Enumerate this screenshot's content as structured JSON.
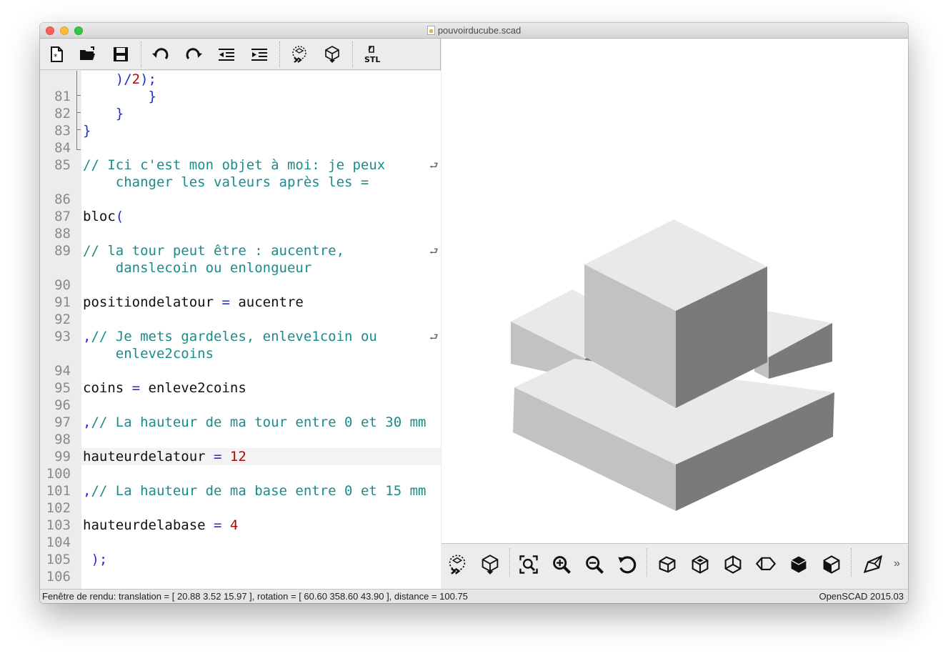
{
  "window": {
    "title": "pouvoirducube.scad"
  },
  "editor_toolbar": {
    "buttons": [
      {
        "name": "new-file",
        "icon": "new-file-icon"
      },
      {
        "name": "open-file",
        "icon": "open-folder-icon"
      },
      {
        "name": "save-file",
        "icon": "save-icon"
      },
      {
        "name": "undo",
        "icon": "undo-icon"
      },
      {
        "name": "redo",
        "icon": "redo-icon"
      },
      {
        "name": "unindent",
        "icon": "unindent-icon"
      },
      {
        "name": "indent",
        "icon": "indent-icon"
      },
      {
        "name": "preview",
        "icon": "preview-icon"
      },
      {
        "name": "render",
        "icon": "render-icon"
      },
      {
        "name": "export-stl",
        "icon": "stl-icon",
        "label": "STL"
      }
    ]
  },
  "code": {
    "current_line": "99",
    "lines": [
      {
        "num": "",
        "text": "    )/2);"
      },
      {
        "num": "81",
        "text": "        }"
      },
      {
        "num": "82",
        "text": "    }"
      },
      {
        "num": "83",
        "text": "}"
      },
      {
        "num": "84",
        "text": ""
      },
      {
        "num": "85",
        "text": "// Ici c'est mon objet à moi: je peux"
      },
      {
        "num": "",
        "text": "    changer les valeurs après les ="
      },
      {
        "num": "86",
        "text": ""
      },
      {
        "num": "87",
        "text": "bloc("
      },
      {
        "num": "88",
        "text": ""
      },
      {
        "num": "89",
        "text": "// la tour peut être : aucentre,"
      },
      {
        "num": "",
        "text": "    danslecoin ou enlongueur"
      },
      {
        "num": "90",
        "text": ""
      },
      {
        "num": "91",
        "text": "positiondelatour = aucentre"
      },
      {
        "num": "92",
        "text": ""
      },
      {
        "num": "93",
        "text": ",// Je mets gardeles, enleve1coin ou"
      },
      {
        "num": "",
        "text": "    enleve2coins"
      },
      {
        "num": "94",
        "text": ""
      },
      {
        "num": "95",
        "text": "coins = enleve2coins"
      },
      {
        "num": "96",
        "text": ""
      },
      {
        "num": "97",
        "text": ",// La hauteur de ma tour entre 0 et 30 mm"
      },
      {
        "num": "98",
        "text": ""
      },
      {
        "num": "99",
        "text": "hauteurdelatour = 12"
      },
      {
        "num": "100",
        "text": ""
      },
      {
        "num": "101",
        "text": ",// La hauteur de ma base entre 0 et 15 mm"
      },
      {
        "num": "102",
        "text": ""
      },
      {
        "num": "103",
        "text": "hauteurdelabase = 4"
      },
      {
        "num": "104",
        "text": ""
      },
      {
        "num": "105",
        "text": " );"
      },
      {
        "num": "106",
        "text": ""
      }
    ],
    "wrap_marker": "⮐"
  },
  "viewer_toolbar": {
    "buttons": [
      {
        "name": "preview",
        "icon": "preview-icon"
      },
      {
        "name": "render",
        "icon": "render-icon"
      },
      {
        "name": "view-all",
        "icon": "zoom-fit-icon"
      },
      {
        "name": "zoom-in",
        "icon": "zoom-in-icon"
      },
      {
        "name": "zoom-out",
        "icon": "zoom-out-icon"
      },
      {
        "name": "reset-view",
        "icon": "reset-view-icon"
      },
      {
        "name": "view-right",
        "icon": "view-right-icon"
      },
      {
        "name": "view-top",
        "icon": "view-top-icon"
      },
      {
        "name": "view-bottom",
        "icon": "view-bottom-icon"
      },
      {
        "name": "view-left",
        "icon": "view-left-icon"
      },
      {
        "name": "view-front",
        "icon": "view-front-icon"
      },
      {
        "name": "view-back",
        "icon": "view-back-icon"
      },
      {
        "name": "perspective",
        "icon": "perspective-icon"
      }
    ],
    "overflow": "»"
  },
  "statusbar": {
    "left": "Fenêtre de rendu: translation = [ 20.88 3.52 15.97 ], rotation = [ 60.60 358.60 43.90 ], distance = 100.75",
    "right": "OpenSCAD 2015.03"
  },
  "colors": {
    "comment": "#198c8c",
    "operator": "#1c2fd0",
    "number": "#a10c0c",
    "top_face": "#e9e9e9",
    "left_face": "#c2c2c2",
    "right_face": "#7a7a7a"
  }
}
